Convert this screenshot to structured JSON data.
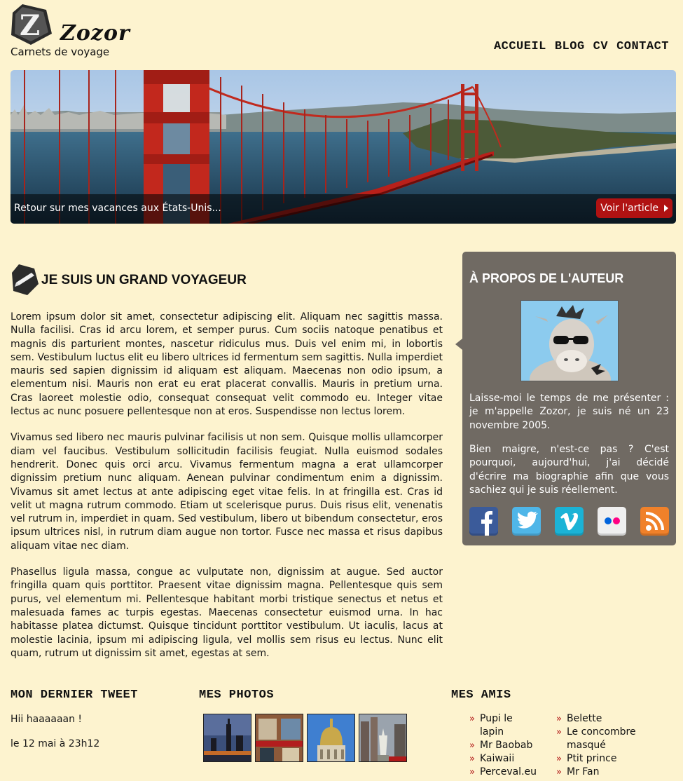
{
  "header": {
    "brand": "Zozor",
    "tagline": "Carnets de voyage",
    "nav": [
      "ACCUEIL",
      "BLOG",
      "CV",
      "CONTACT"
    ]
  },
  "banner": {
    "caption": "Retour sur mes vacances aux États-Unis...",
    "button_label": "Voir l'article"
  },
  "article": {
    "title": "JE SUIS UN GRAND VOYAGEUR",
    "paragraphs": [
      "Lorem ipsum dolor sit amet, consectetur adipiscing elit. Aliquam nec sagittis massa. Nulla facilisi. Cras id arcu lorem, et semper purus. Cum sociis natoque penatibus et magnis dis parturient montes, nascetur ridiculus mus. Duis vel enim mi, in lobortis sem. Vestibulum luctus elit eu libero ultrices id fermentum sem sagittis. Nulla imperdiet mauris sed sapien dignissim id aliquam est aliquam. Maecenas non odio ipsum, a elementum nisi. Mauris non erat eu erat placerat convallis. Mauris in pretium urna. Cras laoreet molestie odio, consequat consequat velit commodo eu. Integer vitae lectus ac nunc posuere pellentesque non at eros. Suspendisse non lectus lorem.",
      "Vivamus sed libero nec mauris pulvinar facilisis ut non sem. Quisque mollis ullamcorper diam vel faucibus. Vestibulum sollicitudin facilisis feugiat. Nulla euismod sodales hendrerit. Donec quis orci arcu. Vivamus fermentum magna a erat ullamcorper dignissim pretium nunc aliquam. Aenean pulvinar condimentum enim a dignissim. Vivamus sit amet lectus at ante adipiscing eget vitae felis. In at fringilla est. Cras id velit ut magna rutrum commodo. Etiam ut scelerisque purus. Duis risus elit, venenatis vel rutrum in, imperdiet in quam. Sed vestibulum, libero ut bibendum consectetur, eros ipsum ultrices nisl, in rutrum diam augue non tortor. Fusce nec massa et risus dapibus aliquam vitae nec diam.",
      "Phasellus ligula massa, congue ac vulputate non, dignissim at augue. Sed auctor fringilla quam quis porttitor. Praesent vitae dignissim magna. Pellentesque quis sem purus, vel elementum mi. Pellentesque habitant morbi tristique senectus et netus et malesuada fames ac turpis egestas. Maecenas consectetur euismod urna. In hac habitasse platea dictumst. Quisque tincidunt porttitor vestibulum. Ut iaculis, lacus at molestie lacinia, ipsum mi adipiscing ligula, vel mollis sem risus eu lectus. Nunc elit quam, rutrum ut dignissim sit amet, egestas at sem."
    ]
  },
  "aside": {
    "title": "À PROPOS DE L'AUTEUR",
    "bio": [
      "Laisse-moi le temps de me présenter : je m'appelle Zozor, je suis né un 23 novembre 2005.",
      "Bien maigre, n'est-ce pas ? C'est pourquoi, aujourd'hui, j'ai décidé d'écrire ma biographie afin que vous sachiez qui je suis réellement."
    ],
    "socials": [
      {
        "icon": "facebook-icon",
        "color": "#3b5b9a"
      },
      {
        "icon": "twitter-icon",
        "color": "#4fb6e8"
      },
      {
        "icon": "vimeo-icon",
        "color": "#1bb3d6"
      },
      {
        "icon": "flickr-icon",
        "color": "#efefef"
      },
      {
        "icon": "rss-icon",
        "color": "#f0812a"
      }
    ]
  },
  "tweet": {
    "title": "MON DERNIER TWEET",
    "text": "Hii haaaaaan !",
    "date": "le 12 mai à 23h12"
  },
  "photos": {
    "title": "MES PHOTOS"
  },
  "friends": {
    "title": "MES AMIS",
    "col1": [
      "Pupi le lapin",
      "Mr Baobab",
      "Kaiwaii",
      "Perceval.eu"
    ],
    "col2": [
      "Belette",
      "Le concombre masqué",
      "Ptit prince",
      "Mr Fan"
    ]
  },
  "colors": {
    "background": "#fdf3cf",
    "accent": "#b01212",
    "aside": "#706a63"
  }
}
